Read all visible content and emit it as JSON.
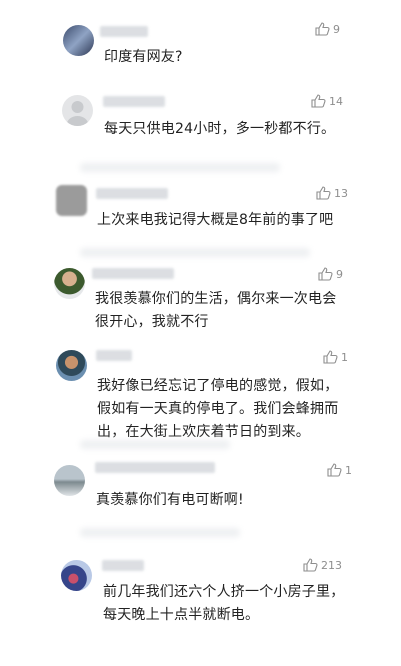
{
  "comments": [
    {
      "likes": "9",
      "text": "印度有网友?"
    },
    {
      "likes": "14",
      "text": "每天只供电24小时，多一秒都不行。"
    },
    {
      "likes": "13",
      "text": "上次来电我记得大概是8年前的事了吧"
    },
    {
      "likes": "9",
      "text_lines": [
        "我很羡慕你们的生活，偶尔来一次电会",
        "很开心，我就不行"
      ]
    },
    {
      "likes": "1",
      "text_lines": [
        "我好像已经忘记了停电的感觉，假如，",
        "假如有一天真的停电了。我们会蜂拥而",
        "出，在大街上欢庆着节日的到来。"
      ]
    },
    {
      "likes": "1",
      "text": "真羡慕你们有电可断啊!"
    },
    {
      "likes": "213",
      "text_lines": [
        "前几年我们还六个人挤一个小房子里，",
        "每天晚上十点半就断电。"
      ]
    }
  ],
  "icons": {
    "like": "thumbs-up-icon"
  }
}
